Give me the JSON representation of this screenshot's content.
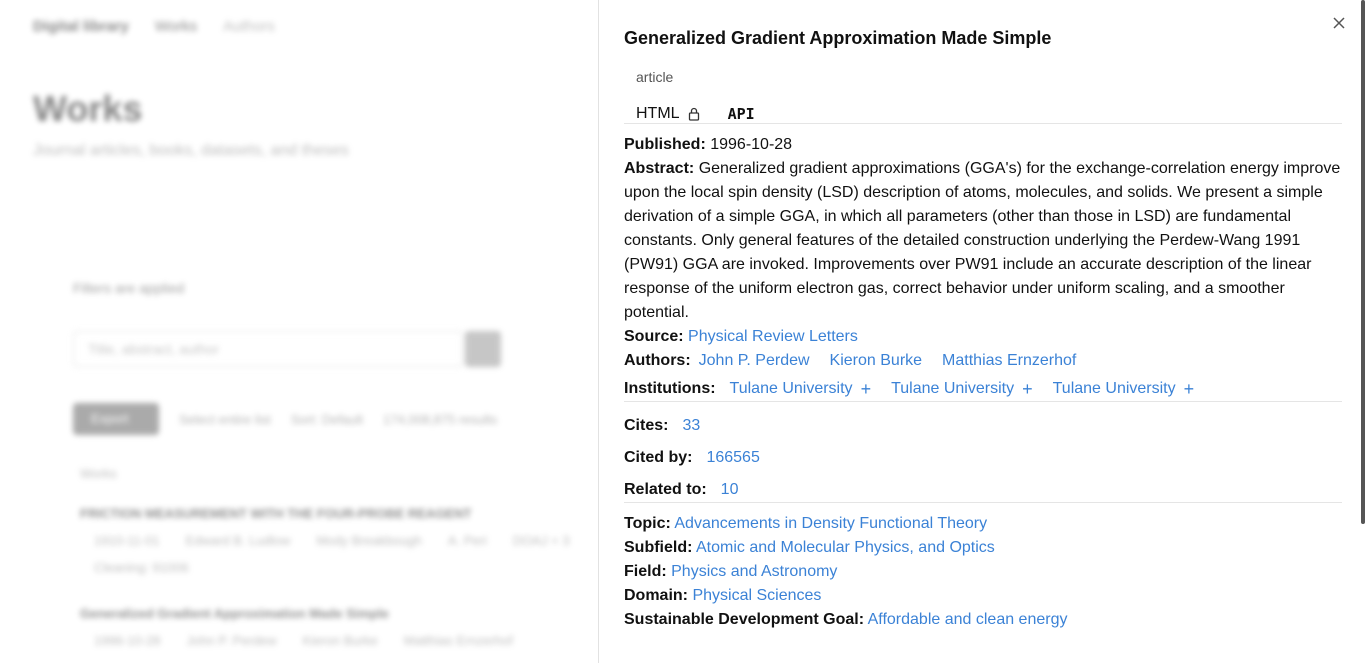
{
  "background": {
    "brand": "Digital library",
    "nav": [
      "Works",
      "Authors"
    ],
    "page_title": "Works",
    "page_subtitle": "Journal articles, books, datasets, and theses",
    "filters_text": "Filters are applied",
    "search_placeholder": "Title, abstract, author",
    "toolbar": {
      "export_label": "Export",
      "select_all": "Select entire list",
      "sort_label": "Sort: Default",
      "results": "174,008,875 results"
    },
    "column_header": "Works",
    "rows": [
      {
        "title": "FRICTION MEASUREMENT WITH THE FOUR-PROBE REAGENT",
        "meta": [
          "1910-11-01",
          "Edward B. Ludlow",
          "Mody Breakbough",
          "A. Peri",
          "DOAJ + 3"
        ],
        "extra": "Cleaning: 91006"
      },
      {
        "title": "Generalized Gradient Approximation Made Simple",
        "meta": [
          "1996-10-28",
          "John P. Perdew",
          "Kieron Burke",
          "Matthias Ernzerhof"
        ]
      }
    ]
  },
  "drawer": {
    "title": "Generalized Gradient Approximation Made Simple",
    "type": "article",
    "formats": {
      "html": "HTML",
      "api": "API"
    },
    "published_label": "Published:",
    "published": "1996-10-28",
    "abstract_label": "Abstract:",
    "abstract": "Generalized gradient approximations (GGA's) for the exchange-correlation energy improve upon the local spin density (LSD) description of atoms, molecules, and solids. We present a simple derivation of a simple GGA, in which all parameters (other than those in LSD) are fundamental constants. Only general features of the detailed construction underlying the Perdew-Wang 1991 (PW91) GGA are invoked. Improvements over PW91 include an accurate description of the linear response of the uniform electron gas, correct behavior under uniform scaling, and a smoother potential.",
    "source_label": "Source:",
    "source": "Physical Review Letters",
    "authors_label": "Authors:",
    "authors": [
      "John P. Perdew",
      "Kieron Burke",
      "Matthias Ernzerhof"
    ],
    "institutions_label": "Institutions:",
    "institutions": [
      "Tulane University",
      "Tulane University",
      "Tulane University"
    ],
    "cites_label": "Cites:",
    "cites": "33",
    "cited_by_label": "Cited by:",
    "cited_by": "166565",
    "related_label": "Related to:",
    "related": "10",
    "topic_label": "Topic:",
    "topic": "Advancements in Density Functional Theory",
    "subfield_label": "Subfield:",
    "subfield": "Atomic and Molecular Physics, and Optics",
    "field_label": "Field:",
    "field": "Physics and Astronomy",
    "domain_label": "Domain:",
    "domain": "Physical Sciences",
    "sdg_label": "Sustainable Development Goal:",
    "sdg": "Affordable and clean energy"
  },
  "colors": {
    "link": "#3b82d6",
    "text": "#111111",
    "divider": "#e5e5e5"
  },
  "icons": {
    "close": "close-icon",
    "lock": "lock-icon",
    "plus": "plus-icon"
  }
}
